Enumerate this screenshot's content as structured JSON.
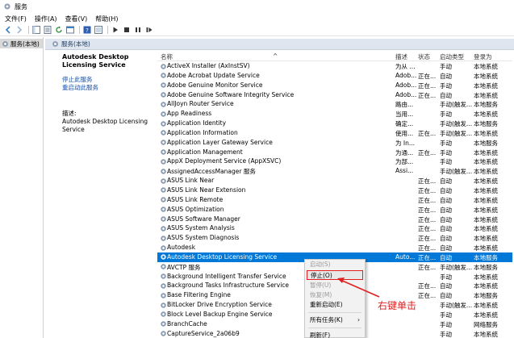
{
  "window": {
    "title": "服务"
  },
  "menu": {
    "file": "文件(F)",
    "action": "操作(A)",
    "view": "查看(V)",
    "help": "帮助(H)"
  },
  "tree": {
    "root_label": "服务(本地)"
  },
  "panel": {
    "header": "服务(本地)"
  },
  "details": {
    "service_title": "Autodesk Desktop Licensing Service",
    "stop_link": "停止此服务",
    "restart_link": "重启动此服务",
    "desc_label": "描述:",
    "desc_text": "Autodesk Desktop Licensing Service"
  },
  "columns": {
    "name": "名称",
    "desc": "描述",
    "status": "状态",
    "startup": "启动类型",
    "logon": "登录为"
  },
  "services": [
    {
      "name": "ActiveX Installer (AxInstSV)",
      "desc": "为从 ...",
      "status": "",
      "startup": "手动",
      "logon": "本地系统"
    },
    {
      "name": "Adobe Acrobat Update Service",
      "desc": "Adob...",
      "status": "正在...",
      "startup": "自动",
      "logon": "本地系统"
    },
    {
      "name": "Adobe Genuine Monitor Service",
      "desc": "Adob...",
      "status": "正在...",
      "startup": "手动",
      "logon": "本地系统"
    },
    {
      "name": "Adobe Genuine Software Integrity Service",
      "desc": "Adob...",
      "status": "正在...",
      "startup": "自动",
      "logon": "本地系统"
    },
    {
      "name": "AllJoyn Router Service",
      "desc": "路由...",
      "status": "",
      "startup": "手动(触发...",
      "logon": "本地服务"
    },
    {
      "name": "App Readiness",
      "desc": "当用...",
      "status": "",
      "startup": "手动",
      "logon": "本地系统"
    },
    {
      "name": "Application Identity",
      "desc": "确定...",
      "status": "",
      "startup": "手动(触发...",
      "logon": "本地服务"
    },
    {
      "name": "Application Information",
      "desc": "使用...",
      "status": "正在...",
      "startup": "手动(触发...",
      "logon": "本地系统"
    },
    {
      "name": "Application Layer Gateway Service",
      "desc": "为 In...",
      "status": "",
      "startup": "手动",
      "logon": "本地服务"
    },
    {
      "name": "Application Management",
      "desc": "为通...",
      "status": "正在...",
      "startup": "手动",
      "logon": "本地系统"
    },
    {
      "name": "AppX Deployment Service (AppXSVC)",
      "desc": "为部...",
      "status": "",
      "startup": "手动",
      "logon": "本地系统"
    },
    {
      "name": "AssignedAccessManager 服务",
      "desc": "Assi...",
      "status": "",
      "startup": "手动(触发...",
      "logon": "本地系统"
    },
    {
      "name": "ASUS Link Near",
      "desc": "",
      "status": "正在...",
      "startup": "自动",
      "logon": "本地系统"
    },
    {
      "name": "ASUS Link Near Extension",
      "desc": "",
      "status": "正在...",
      "startup": "自动",
      "logon": "本地系统"
    },
    {
      "name": "ASUS Link Remote",
      "desc": "",
      "status": "正在...",
      "startup": "自动",
      "logon": "本地系统"
    },
    {
      "name": "ASUS Optimization",
      "desc": "",
      "status": "正在...",
      "startup": "自动",
      "logon": "本地系统"
    },
    {
      "name": "ASUS Software Manager",
      "desc": "",
      "status": "正在...",
      "startup": "自动",
      "logon": "本地系统"
    },
    {
      "name": "ASUS System Analysis",
      "desc": "",
      "status": "正在...",
      "startup": "自动",
      "logon": "本地系统"
    },
    {
      "name": "ASUS System Diagnosis",
      "desc": "",
      "status": "正在...",
      "startup": "自动",
      "logon": "本地系统"
    },
    {
      "name": "Autodesk",
      "desc": "",
      "status": "正在...",
      "startup": "自动",
      "logon": "本地系统"
    },
    {
      "name": "Autodesk Desktop Licensing Service",
      "desc": "Auto...",
      "status": "正在...",
      "startup": "自动",
      "logon": "本地服务",
      "selected": true
    },
    {
      "name": "AVCTP 服务",
      "desc": "",
      "status": "正在...",
      "startup": "手动(触发...",
      "logon": "本地服务"
    },
    {
      "name": "Background Intelligent Transfer Service",
      "desc": "",
      "status": "",
      "startup": "手动",
      "logon": "本地系统"
    },
    {
      "name": "Background Tasks Infrastructure Service",
      "desc": "",
      "status": "正在...",
      "startup": "自动",
      "logon": "本地系统"
    },
    {
      "name": "Base Filtering Engine",
      "desc": "",
      "status": "正在...",
      "startup": "自动",
      "logon": "本地服务"
    },
    {
      "name": "BitLocker Drive Encryption Service",
      "desc": "",
      "status": "",
      "startup": "手动(触发...",
      "logon": "本地系统"
    },
    {
      "name": "Block Level Backup Engine Service",
      "desc": "",
      "status": "",
      "startup": "手动",
      "logon": "本地系统"
    },
    {
      "name": "BranchCache",
      "desc": "",
      "status": "",
      "startup": "手动",
      "logon": "网络服务"
    },
    {
      "name": "CaptureService_2a06b9",
      "desc": "",
      "status": "",
      "startup": "手动",
      "logon": "本地系统"
    }
  ],
  "context_menu": {
    "start": "启动(S)",
    "stop": "停止(O)",
    "pause": "暂停(U)",
    "resume": "恢复(M)",
    "restart": "重新启动(E)",
    "all_tasks": "所有任务(K)",
    "refresh": "刷新(F)"
  },
  "annotation": {
    "label": "右键单击"
  },
  "colors": {
    "selection": "#0078d7",
    "annotation": "#e02020",
    "link": "#1a4fa8"
  }
}
